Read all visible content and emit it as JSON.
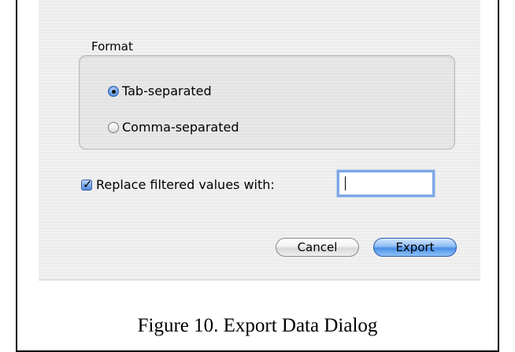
{
  "dialog": {
    "format_group": {
      "title": "Format",
      "options": [
        {
          "label": "Tab-separated",
          "selected": true
        },
        {
          "label": "Comma-separated",
          "selected": false
        }
      ]
    },
    "replace_filtered": {
      "label": "Replace filtered values with:",
      "checked": true,
      "input_value": ""
    },
    "buttons": {
      "cancel_label": "Cancel",
      "export_label": "Export"
    },
    "colors": {
      "default_button": "#4a90e6",
      "focus_ring": "#7ea6e6"
    }
  },
  "caption": "Figure 10.  Export Data Dialog"
}
